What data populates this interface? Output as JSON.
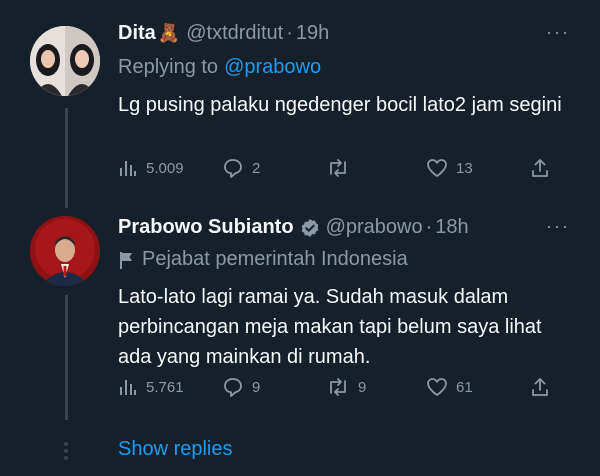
{
  "tweets": [
    {
      "name": "Dita",
      "emoji": "🧸",
      "handle": "@txtdrditut",
      "dot": "·",
      "time": "19h",
      "replying_prefix": "Replying to",
      "replying_handle": "@prabowo",
      "text": "Lg pusing palaku ngedenger bocil lato2 jam segini",
      "metrics": {
        "views": "5.009",
        "replies": "2",
        "retweets": "",
        "likes": "13"
      }
    },
    {
      "name": "Prabowo Subianto",
      "verified": true,
      "handle": "@prabowo",
      "dot": "·",
      "time": "18h",
      "label": "Pejabat pemerintah Indonesia",
      "text": "Lato-lato lagi ramai ya. Sudah masuk dalam perbincangan meja makan tapi belum saya lihat ada yang mainkan di rumah.",
      "metrics": {
        "views": "5.761",
        "replies": "9",
        "retweets": "9",
        "likes": "61"
      }
    }
  ],
  "more_label": "···",
  "show_replies": "Show replies",
  "colors": {
    "background": "#15202b",
    "accent": "#1d9bf0",
    "muted": "#8b98a5",
    "verified": "#8b98a5"
  }
}
